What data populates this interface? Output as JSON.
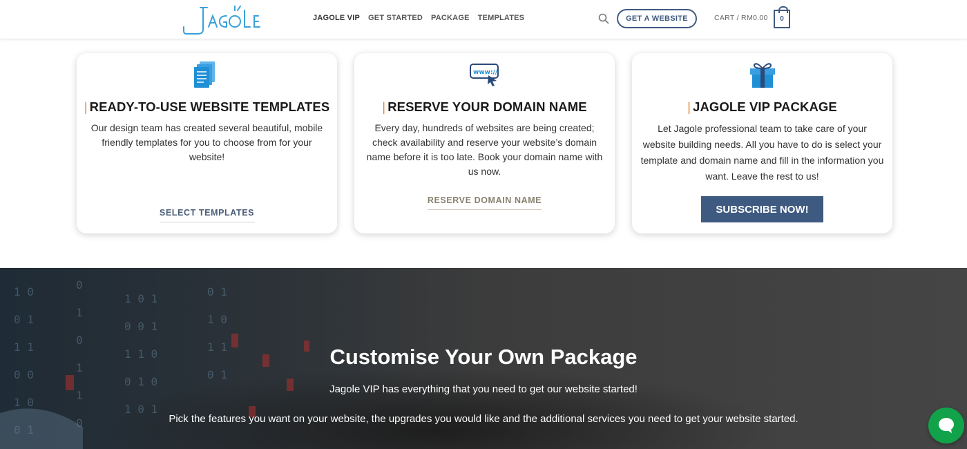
{
  "header": {
    "logo_text": "Jagole",
    "nav": [
      "JAGOLE VIP",
      "GET STARTED",
      "PACKAGE",
      "TEMPLATES"
    ],
    "cta_label": "GET A WEBSITE",
    "cart_label": "CART / RM0.00",
    "cart_count": "0"
  },
  "icons": {
    "search": "search-icon",
    "templates": "documents-icon",
    "domain": "www-cursor-icon",
    "vip": "gift-icon",
    "chat": "chat-bubble-icon"
  },
  "cards": [
    {
      "title": "READY-TO-USE WEBSITE TEMPLATES",
      "description": "Our design team has created several beautiful, mobile friendly templates for you to choose from for your website!",
      "link": "SELECT TEMPLATES"
    },
    {
      "title": "RESERVE YOUR DOMAIN NAME",
      "description": "Every day, hundreds of websites are being created; check availability and reserve your website’s domain name before it is too late. Book your domain name with us now.",
      "link": "RESERVE DOMAIN NAME"
    },
    {
      "title": "JAGOLE VIP PACKAGE",
      "description": "Let Jagole professional team to take care of your website building needs. All you have to do is select your template and domain name and fill in the information you want. Leave the rest to us!",
      "button": "SUBSCRIBE NOW!"
    }
  ],
  "package": {
    "title": "Customise Your Own Package",
    "subtitle": "Jagole VIP has everything that you need to get our website started!",
    "body": "Pick the features you want on your website, the upgrades you would like and the additional services you need to get your website started."
  },
  "colors": {
    "accent": "#3f5a80",
    "title_bar": "#e8893a",
    "chat": "#12a34a",
    "icon_blue": "#1f8fd6"
  }
}
